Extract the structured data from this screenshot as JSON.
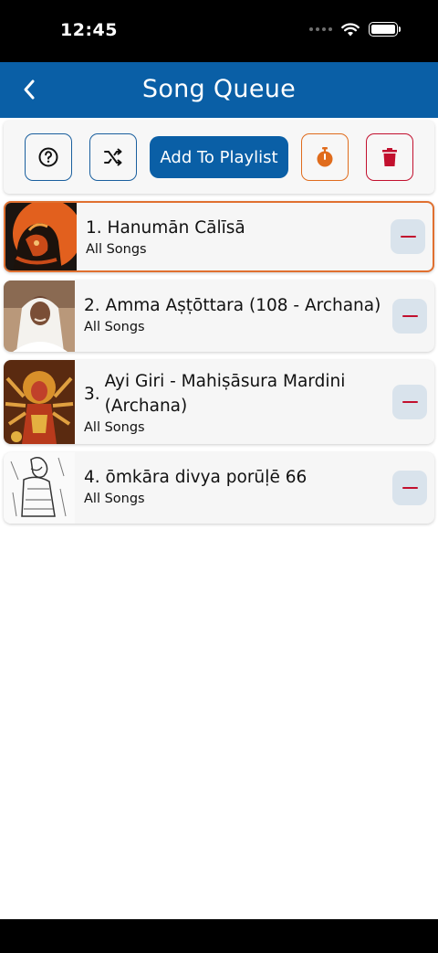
{
  "status_bar": {
    "time": "12:45"
  },
  "header": {
    "title": "Song Queue"
  },
  "toolbar": {
    "add_to_playlist_label": "Add To Playlist"
  },
  "songs": [
    {
      "number": "1.",
      "title": "Hanumān Cālīsā",
      "subtitle": "All Songs",
      "active": true
    },
    {
      "number": "2.",
      "title": "Amma Aṣṭōttara (108 - Archana)",
      "subtitle": "All Songs",
      "active": false
    },
    {
      "number": "3.",
      "title": "Ayi Giri - Mahiṣāsura Mardini (Archana)",
      "subtitle": "All Songs",
      "active": false
    },
    {
      "number": "4.",
      "title": "ōmkāra divya porūḷē 66",
      "subtitle": "All Songs",
      "active": false
    }
  ],
  "colors": {
    "header_bg": "#0a5fa6",
    "accent_orange": "#e06c1d",
    "danger_red": "#c2102e",
    "remove_btn_bg": "#d9e3ec"
  }
}
